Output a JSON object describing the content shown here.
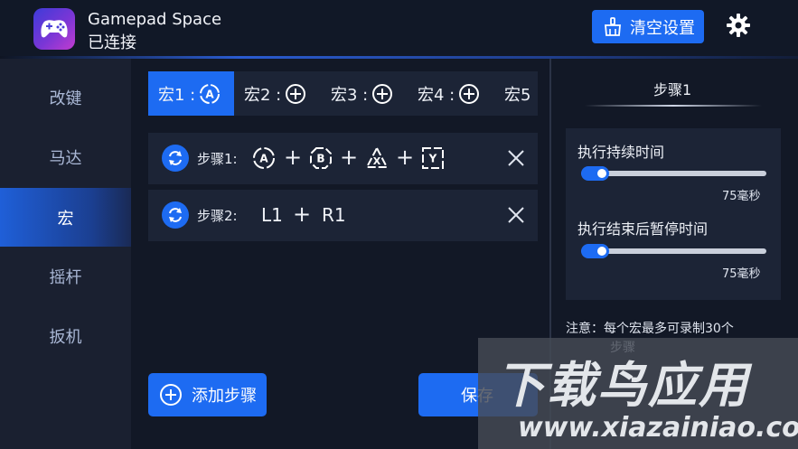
{
  "header": {
    "app_name": "Gamepad Space",
    "status": "已连接",
    "clear_button": "清空设置",
    "icon": "gamepad-icon",
    "accent": "#1d6bf2"
  },
  "sidebar": {
    "items": [
      {
        "label": "改键",
        "active": false
      },
      {
        "label": "马达",
        "active": false
      },
      {
        "label": "宏",
        "active": true
      },
      {
        "label": "摇杆",
        "active": false
      },
      {
        "label": "扳机",
        "active": false
      }
    ]
  },
  "macros": {
    "tabs": [
      {
        "label": "宏1 :",
        "icon": "a-button-icon",
        "active": true
      },
      {
        "label": "宏2 :",
        "icon": "add-circle-icon",
        "active": false
      },
      {
        "label": "宏3 :",
        "icon": "add-circle-icon",
        "active": false
      },
      {
        "label": "宏4 :",
        "icon": "add-circle-icon",
        "active": false
      },
      {
        "label": "宏5",
        "icon": "",
        "active": false
      }
    ],
    "steps": [
      {
        "label": "步骤1:",
        "keys": [
          "A",
          "B",
          "X",
          "Y"
        ]
      },
      {
        "label": "步骤2:",
        "keys": [
          "L1",
          "R1"
        ]
      }
    ],
    "add_step_button": "添加步骤",
    "save_button": "保存"
  },
  "right_panel": {
    "title": "步骤1",
    "duration_label": "执行持续时间",
    "duration_value": "75毫秒",
    "pause_label": "执行结束后暂停时间",
    "pause_value": "75毫秒",
    "note": "注意：每个宏最多可录制30个",
    "note_cont": "步骤"
  },
  "watermark": {
    "title": "下载鸟应用",
    "url": "www.xiazainiao.com"
  }
}
